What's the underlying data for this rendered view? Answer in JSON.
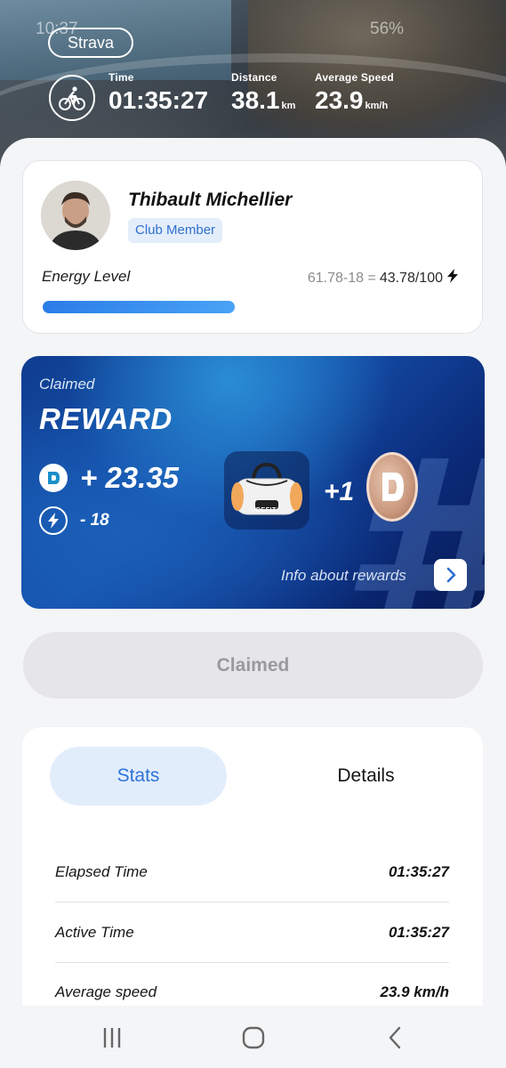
{
  "status_bar": {
    "time": "10:37",
    "battery": "56%"
  },
  "header": {
    "source_chip": "Strava",
    "activity_icon": "cyclist-icon",
    "metrics": [
      {
        "label": "Time",
        "value": "01:35:27",
        "unit": ""
      },
      {
        "label": "Distance",
        "value": "38.1",
        "unit": "km"
      },
      {
        "label": "Average Speed",
        "value": "23.9",
        "unit": "km/h"
      }
    ]
  },
  "profile": {
    "name": "Thibault Michellier",
    "badge": "Club Member",
    "energy_label": "Energy Level",
    "energy_calc_prefix": "61.78-18 =",
    "energy_calc_result": "43.78/100",
    "energy_fraction": 0.4378
  },
  "reward": {
    "status_label": "Claimed",
    "title": "REWARD",
    "token_amount": "+ 23.35",
    "energy_cost": "- 18",
    "item_bonus": "+1",
    "bag_brand": "DEFIT",
    "info_link": "Info about rewards",
    "colors": {
      "card_start": "#0f3d8f",
      "card_end": "#071a55"
    }
  },
  "claimed_button": {
    "label": "Claimed"
  },
  "stats": {
    "tabs": [
      {
        "label": "Stats",
        "active": true
      },
      {
        "label": "Details",
        "active": false
      }
    ],
    "rows": [
      {
        "key": "Elapsed Time",
        "value": "01:35:27"
      },
      {
        "key": "Active Time",
        "value": "01:35:27"
      },
      {
        "key": "Average speed",
        "value": "23.9 km/h"
      }
    ]
  },
  "navbar": {
    "items": [
      "recent-apps-icon",
      "home-icon",
      "back-icon"
    ]
  }
}
